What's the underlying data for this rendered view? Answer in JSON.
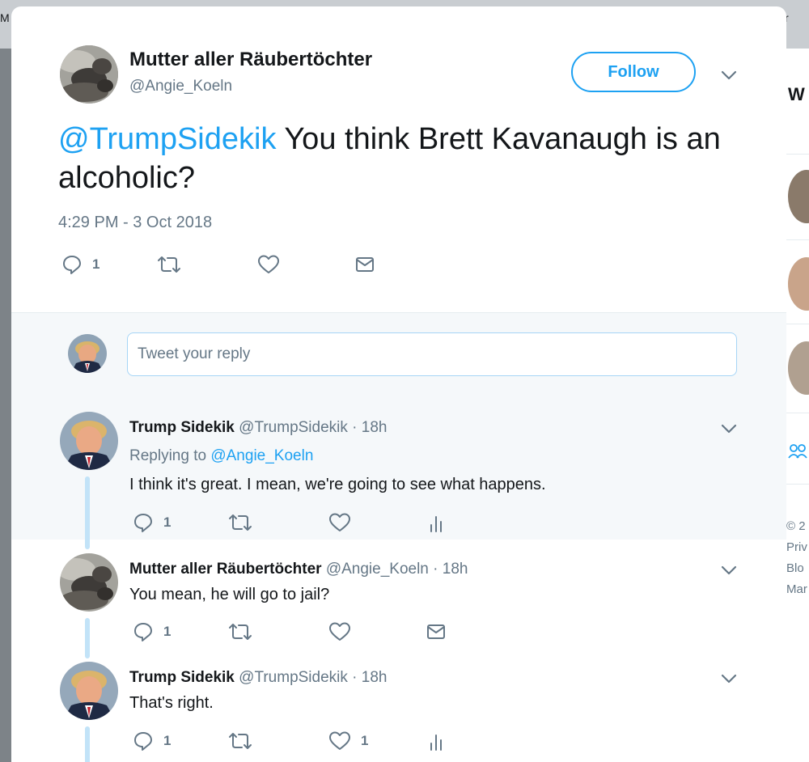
{
  "background": {
    "top_left_fragment": "M",
    "top_right_fragment": "r",
    "sidebar_fragment": "W",
    "footer_lines": [
      "© 2",
      "Priv",
      "Blo",
      "Mar"
    ]
  },
  "tweet": {
    "author_name": "Mutter aller Räubertöchter",
    "author_handle": "@Angie_Koeln",
    "follow_label": "Follow",
    "mention": "@TrumpSidekik",
    "text": " You think Brett Kavanaugh is an alcoholic?",
    "timestamp": "4:29 PM - 3 Oct 2018",
    "reply_count": "1"
  },
  "reply_box": {
    "placeholder": "Tweet your reply"
  },
  "replies": [
    {
      "name": "Trump Sidekik",
      "handle": "@TrumpSidekik",
      "time": "· 18h",
      "replying_prefix": "Replying to",
      "replying_to": "@Angie_Koeln",
      "text": "I think it's great. I mean, we're going to see what happens.",
      "reply_count": "1",
      "like_count": ""
    },
    {
      "name": "Mutter aller Räubertöchter",
      "handle": "@Angie_Koeln",
      "time": "· 18h",
      "text": "You mean, he will go to jail?",
      "reply_count": "1",
      "like_count": ""
    },
    {
      "name": "Trump Sidekik",
      "handle": "@TrumpSidekik",
      "time": "· 18h",
      "text": "That's right.",
      "reply_count": "1",
      "like_count": "1"
    }
  ],
  "colors": {
    "accent": "#1da1f2",
    "muted": "#657786",
    "thread_line": "#c2e3f8",
    "highlight_bg": "#f5f8fa"
  },
  "icons": {
    "reply": "reply-icon",
    "retweet": "retweet-icon",
    "like": "heart-icon",
    "dm": "envelope-icon",
    "analytics": "analytics-icon",
    "caret": "chevron-down-icon"
  }
}
